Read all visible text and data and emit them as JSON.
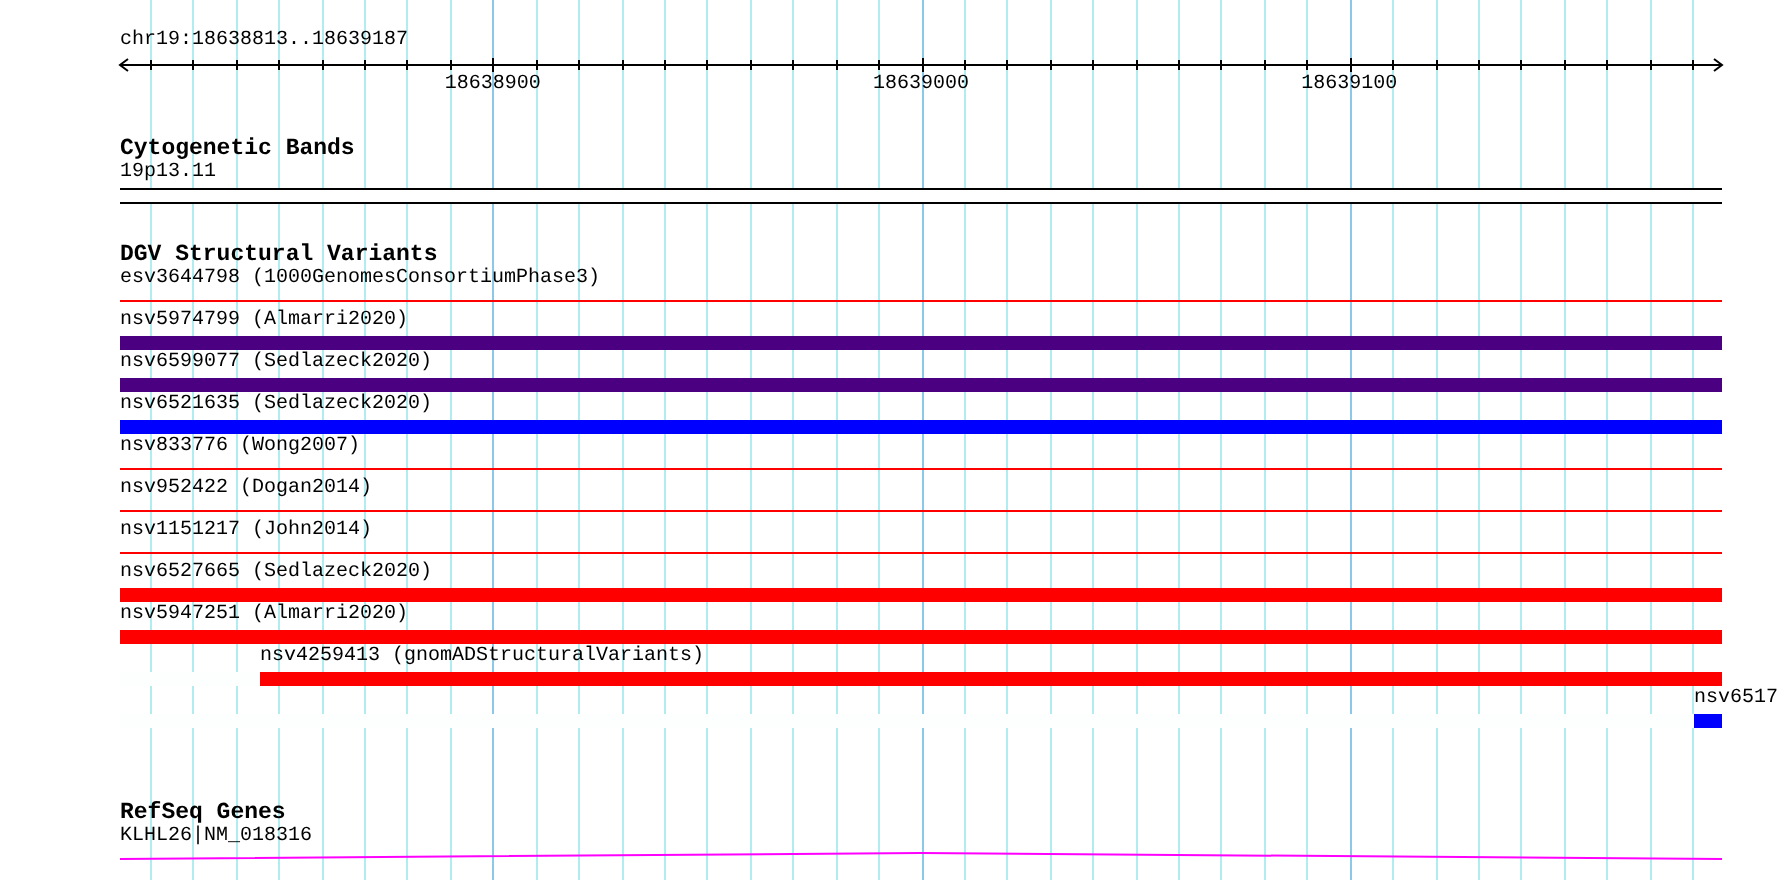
{
  "ruler": {
    "label": "chr19:18638813..18639187",
    "ticks": [
      "18638900",
      "18639000",
      "18639100"
    ]
  },
  "tracks": [
    {
      "title": "Cytogenetic Bands",
      "features": [
        {
          "label": "19p13.11",
          "kind": "band"
        }
      ]
    },
    {
      "title": "DGV Structural Variants",
      "features": [
        {
          "label": "esv3644798 (1000GenomesConsortiumPhase3)",
          "kind": "line",
          "color": "#ff0000"
        },
        {
          "label": "nsv5974799 (Almarri2020)",
          "kind": "bar",
          "color": "#4b0082"
        },
        {
          "label": "nsv6599077 (Sedlazeck2020)",
          "kind": "bar",
          "color": "#4b0082"
        },
        {
          "label": "nsv6521635 (Sedlazeck2020)",
          "kind": "bar",
          "color": "#0000ff"
        },
        {
          "label": "nsv833776 (Wong2007)",
          "kind": "line",
          "color": "#ff0000"
        },
        {
          "label": "nsv952422 (Dogan2014)",
          "kind": "line",
          "color": "#ff0000"
        },
        {
          "label": "nsv1151217 (John2014)",
          "kind": "line",
          "color": "#ff0000"
        },
        {
          "label": "nsv6527665 (Sedlazeck2020)",
          "kind": "bar",
          "color": "#ff0000"
        },
        {
          "label": "nsv5947251 (Almarri2020)",
          "kind": "bar",
          "color": "#ff0000"
        },
        {
          "label": "nsv4259413 (gnomADStructuralVariants)",
          "kind": "bar",
          "color": "#ff0000",
          "level": 0.912
        },
        {
          "label": "nsv6517",
          "kind": "bar",
          "color": "#0000ff",
          "level": 0.018
        }
      ]
    },
    {
      "title": "RefSeq Genes",
      "features": [
        {
          "label": "KLHL26|NM_018316",
          "kind": "intron",
          "color": "#ff00ff"
        }
      ]
    }
  ]
}
